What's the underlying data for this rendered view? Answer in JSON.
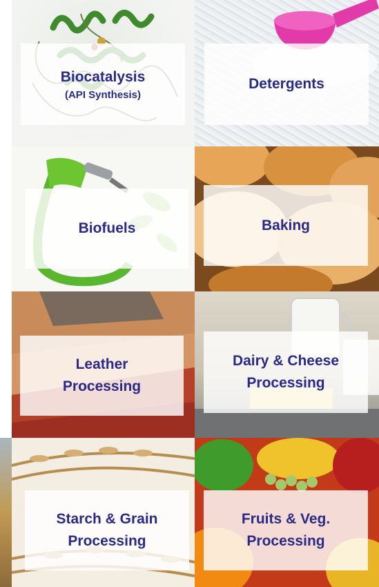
{
  "tiles": [
    {
      "title": "Biocatalysis",
      "subtitle": "(API Synthesis)"
    },
    {
      "title": "Detergents"
    },
    {
      "title": "Biofuels"
    },
    {
      "title": "Baking"
    },
    {
      "title": "Leather",
      "title2": "Processing"
    },
    {
      "title": "Dairy & Cheese",
      "title2": "Processing"
    },
    {
      "title": "Starch & Grain",
      "title2": "Processing"
    },
    {
      "title": "Fruits & Veg.",
      "title2": "Processing"
    }
  ],
  "colors": {
    "text": "#2a2a86",
    "overlay": "rgba(255,255,255,0.82)"
  },
  "images": [
    "enzyme-protein-structure",
    "detergent-powder-scoop",
    "fuel-nozzle-leaves",
    "bread-rolls",
    "leather-swatches",
    "milk-jug-cheese",
    "wheat-grain-ears",
    "fruits-vegetables"
  ]
}
